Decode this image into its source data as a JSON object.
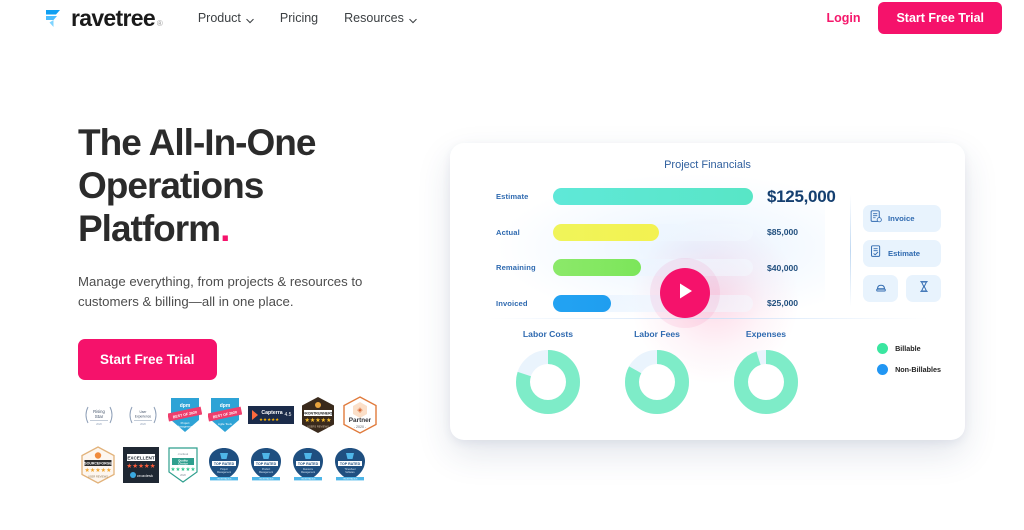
{
  "brand": {
    "name": "ravetree",
    "registered_mark": "®",
    "logo_color": "#29a3f5",
    "accent_color": "#f5126b"
  },
  "nav": {
    "links": [
      {
        "label": "Product",
        "has_caret": true,
        "icon": "chevron-down-icon"
      },
      {
        "label": "Pricing",
        "has_caret": false,
        "icon": ""
      },
      {
        "label": "Resources",
        "has_caret": true,
        "icon": "chevron-down-icon"
      }
    ],
    "login_label": "Login",
    "cta_label": "Start Free Trial"
  },
  "hero": {
    "title_line1": "The All-In-One",
    "title_line2": "Operations",
    "title_line3": "Platform",
    "title_dot": ".",
    "subtitle": "Manage everything, from projects & resources to customers & billing—all in one place.",
    "cta_label": "Start Free Trial"
  },
  "badges": {
    "row1": [
      {
        "name": "rising-star-badge",
        "text": "Rising Star",
        "sub": "2020"
      },
      {
        "name": "user-experience-badge",
        "text": "User Experience",
        "sub": "2020"
      },
      {
        "name": "best-of-2020-project-badge",
        "text": "BEST OF 2020",
        "sub": "Project Management"
      },
      {
        "name": "best-of-2020-agile-badge",
        "text": "BEST OF 2020",
        "sub": "Agile Tools"
      },
      {
        "name": "capterra-badge",
        "text": "Capterra",
        "sub": "4.5"
      },
      {
        "name": "software-advice-front-runners-badge",
        "text": "FRONT RUNNERS",
        "sub": "USERS REVIEWS"
      },
      {
        "name": "partner-2020-badge",
        "text": "Partner",
        "sub": "- 2020 -"
      }
    ],
    "row2": [
      {
        "name": "sourceforge-badge",
        "text": "SOURCEFORGE",
        "sub": "USER REVIEWS"
      },
      {
        "name": "excellent-crozdesk-badge",
        "text": "EXCELLENT",
        "sub": "Crozdesk"
      },
      {
        "name": "quality-choice-badge",
        "text": "Quality Choice",
        "sub": "2020"
      },
      {
        "name": "top-rated-project-badge",
        "text": "TOP RATED",
        "sub": "Project Management Software"
      },
      {
        "name": "top-rated-pm-badge",
        "text": "TOP RATED",
        "sub": "Product Management Software"
      },
      {
        "name": "top-rated-resource-badge",
        "text": "TOP RATED",
        "sub": "Resource Management Software"
      },
      {
        "name": "top-rated-timesheet-badge",
        "text": "TOP RATED",
        "sub": "Timesheet Software"
      }
    ]
  },
  "dashboard": {
    "title": "Project Financials",
    "actions": [
      {
        "label": "Invoice",
        "icon": "invoice-document-icon"
      },
      {
        "label": "Estimate",
        "icon": "estimate-document-icon"
      }
    ],
    "small_actions": [
      {
        "label": "",
        "icon": "stamp-icon"
      },
      {
        "label": "",
        "icon": "hourglass-icon"
      }
    ],
    "play_button_label": "play-video"
  },
  "chart_data": [
    {
      "type": "bar",
      "title": "Project Financials",
      "orientation": "horizontal",
      "categories": [
        "Estimate",
        "Actual",
        "Remaining",
        "Invoiced"
      ],
      "values": [
        125000,
        85000,
        40000,
        25000
      ],
      "value_labels": [
        "$125,000",
        "$85,000",
        "$40,000",
        "$25,000"
      ],
      "colors": [
        "#5fe8d0",
        "#f1f055",
        "#85e860",
        "#1f9ef0"
      ],
      "bar_widths_pct": [
        100,
        53,
        44,
        29
      ],
      "xlabel": "",
      "ylabel": "",
      "grid": false,
      "legend": "none"
    },
    {
      "type": "pie",
      "title": "Labor Costs",
      "labels": [
        "Billable",
        "Non-Billables"
      ],
      "values": [
        80,
        20
      ],
      "colors": [
        "#7eecc8",
        "#e6f3fc"
      ],
      "donut": true
    },
    {
      "type": "pie",
      "title": "Labor Fees",
      "labels": [
        "Billable",
        "Non-Billables"
      ],
      "values": [
        83,
        17
      ],
      "colors": [
        "#7eecc8",
        "#e6f3fc"
      ],
      "donut": true
    },
    {
      "type": "pie",
      "title": "Expenses",
      "labels": [
        "Billable",
        "Non-Billables"
      ],
      "values": [
        95,
        5
      ],
      "colors": [
        "#7eecc8",
        "#e6f3fc"
      ],
      "donut": true
    }
  ],
  "legend": {
    "items": [
      {
        "label": "Billable",
        "color": "#3ae6a0"
      },
      {
        "label": "Non-Billables",
        "color": "#2196f3"
      }
    ]
  }
}
